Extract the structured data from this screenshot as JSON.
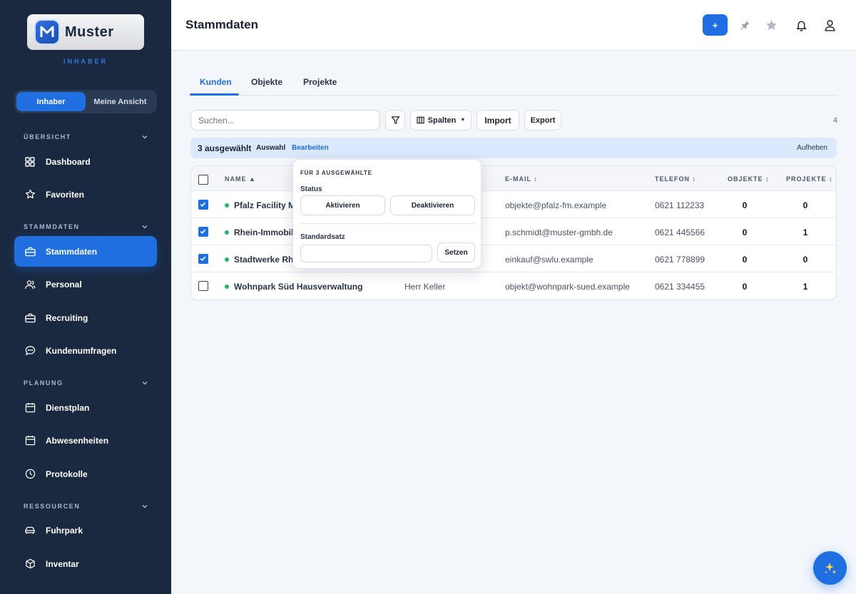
{
  "brand": {
    "name": "Muster",
    "role": "INHABER"
  },
  "view_toggle": {
    "options": [
      "Inhaber",
      "Meine Ansicht"
    ],
    "active": "Inhaber"
  },
  "sidebar": {
    "sections": [
      {
        "label": "ÜBERSICHT",
        "items": [
          {
            "label": "Dashboard",
            "icon": "grid-icon"
          },
          {
            "label": "Favoriten",
            "icon": "star-icon"
          }
        ]
      },
      {
        "label": "STAMMDATEN",
        "items": [
          {
            "label": "Stammdaten",
            "icon": "briefcase-icon",
            "active": true
          },
          {
            "label": "Personal",
            "icon": "users-icon"
          },
          {
            "label": "Recruiting",
            "icon": "briefcase-icon"
          },
          {
            "label": "Kundenumfragen",
            "icon": "chat-icon"
          }
        ]
      },
      {
        "label": "PLANUNG",
        "items": [
          {
            "label": "Dienstplan",
            "icon": "calendar-icon"
          },
          {
            "label": "Abwesenheiten",
            "icon": "calendar-icon"
          },
          {
            "label": "Protokolle",
            "icon": "clock-icon"
          }
        ]
      },
      {
        "label": "RESSOURCEN",
        "items": [
          {
            "label": "Fuhrpark",
            "icon": "car-icon"
          },
          {
            "label": "Inventar",
            "icon": "box-icon"
          }
        ]
      }
    ]
  },
  "header": {
    "title": "Stammdaten",
    "add_label": "+"
  },
  "tabs": [
    {
      "label": "Kunden",
      "active": true
    },
    {
      "label": "Objekte"
    },
    {
      "label": "Projekte"
    }
  ],
  "toolbar": {
    "search_placeholder": "Suchen...",
    "columns_label": "Spalten",
    "import_label": "Import",
    "export_label": "Export",
    "count": "4"
  },
  "selection": {
    "count_label": "3 ausgewählt",
    "select_label": "Auswahl",
    "edit_label": "Bearbeiten",
    "clear_label": "Aufheben"
  },
  "popover": {
    "heading": "FÜR 3 AUSGEWÄHLTE",
    "status_label": "Status",
    "activate_label": "Aktivieren",
    "deactivate_label": "Deaktivieren",
    "rate_label": "Standardsatz",
    "rate_value": "",
    "set_label": "Setzen"
  },
  "table": {
    "columns": [
      "NAME ▲",
      "E-MAIL ↕",
      "TELEFON ↕",
      "OBJEKTE ↕",
      "PROJEKTE ↕"
    ],
    "rows": [
      {
        "checked": true,
        "name": "Pfalz Facility Ma",
        "contact": "",
        "email": "objekte@pfalz-fm.example",
        "phone": "0621 112233",
        "objects": "0",
        "projects": "0"
      },
      {
        "checked": true,
        "name": "Rhein-Immobili",
        "contact": "",
        "email": "p.schmidt@muster-gmbh.de",
        "phone": "0621 445566",
        "objects": "0",
        "projects": "1"
      },
      {
        "checked": true,
        "name": "Stadtwerke Rhe",
        "contact": "",
        "email": "einkauf@swlu.example",
        "phone": "0621 778899",
        "objects": "0",
        "projects": "0"
      },
      {
        "checked": false,
        "name": "Wohnpark Süd Hausverwaltung",
        "contact": "Herr Keller",
        "email": "objekt@wohnpark-sued.example",
        "phone": "0621 334455",
        "objects": "0",
        "projects": "1"
      }
    ]
  },
  "colors": {
    "sidebar": "#1a2840",
    "accent": "#1f6fe0",
    "status_active": "#1fb866",
    "selection_bar": "#dce8fb"
  }
}
